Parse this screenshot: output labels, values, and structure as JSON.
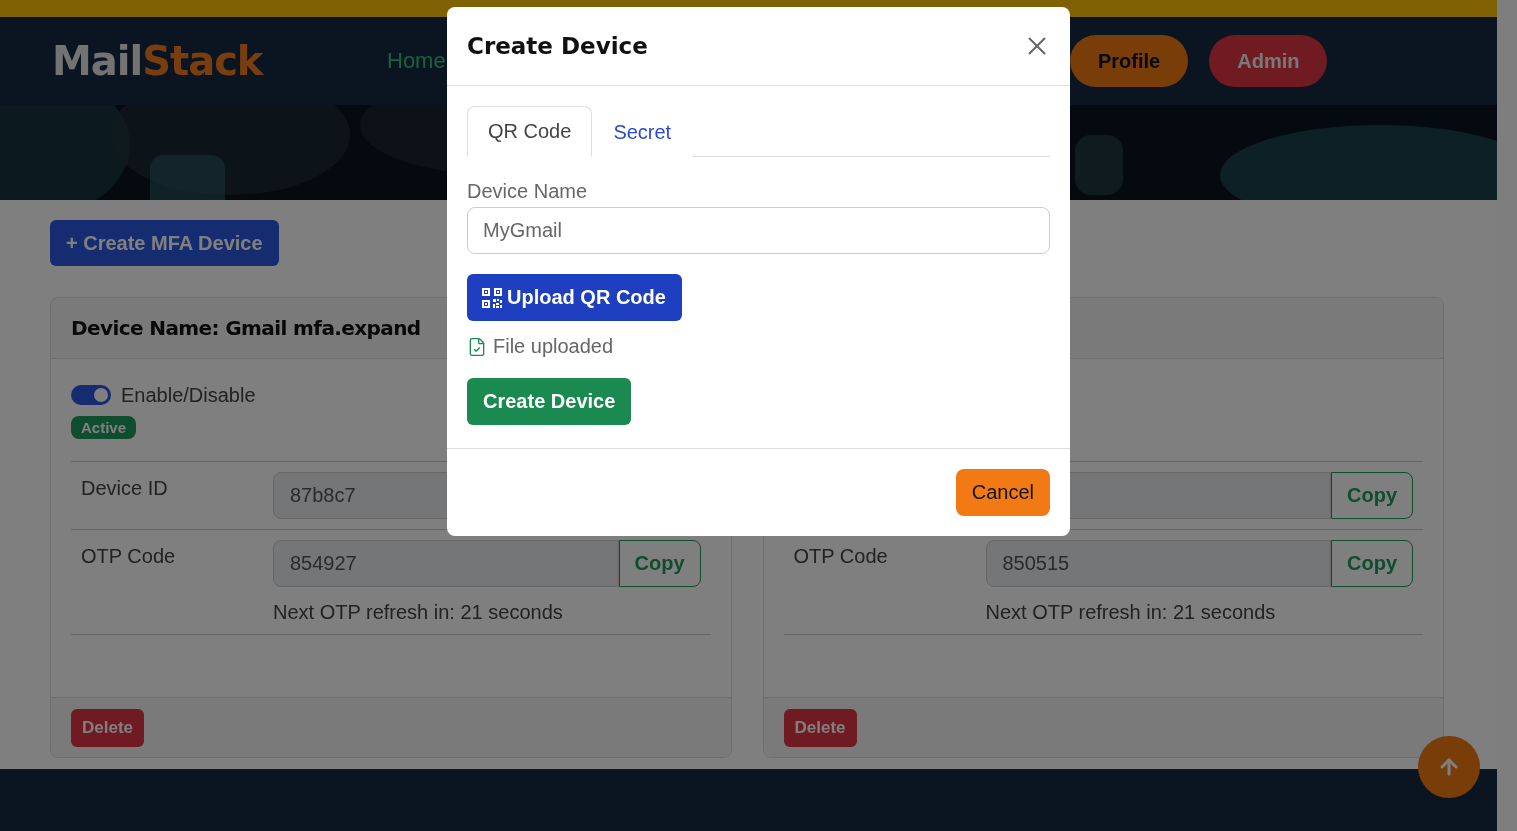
{
  "brand": {
    "part_1": "Mail",
    "part_2": "Stack"
  },
  "nav": {
    "links": [
      {
        "label": "Home"
      }
    ],
    "buttons": [
      {
        "label": "Profile",
        "kind": "profile"
      },
      {
        "label": "Admin",
        "kind": "admin"
      }
    ]
  },
  "create_button": "+ Create MFA Device",
  "cards": [
    {
      "title": "Device Name: Gmail mfa.expand",
      "enabled": true,
      "toggle_label": "Enable/Disable",
      "status_badge": "Active",
      "rows": [
        {
          "label": "Device ID",
          "value": "87b8c7"
        },
        {
          "label": "OTP Code",
          "value": "854927",
          "copy_label": "Copy",
          "note": "Next OTP refresh in: 21 seconds"
        }
      ],
      "delete_label": "Delete"
    },
    {
      "rows": [
        {
          "copy_label": "Copy"
        },
        {
          "label": "OTP Code",
          "value": "850515",
          "copy_label": "Copy",
          "note": "Next OTP refresh in: 21 seconds"
        }
      ],
      "delete_label": "Delete"
    }
  ],
  "modal": {
    "title": "Create Device",
    "tabs": [
      {
        "label": "QR Code",
        "selected": true
      },
      {
        "label": "Secret",
        "selected": false
      }
    ],
    "field": {
      "label": "Device Name",
      "placeholder": "MyGmail"
    },
    "upload_button": "Upload QR Code",
    "file_status": "File uploaded",
    "create_button": "Create Device",
    "cancel_button": "Cancel"
  }
}
